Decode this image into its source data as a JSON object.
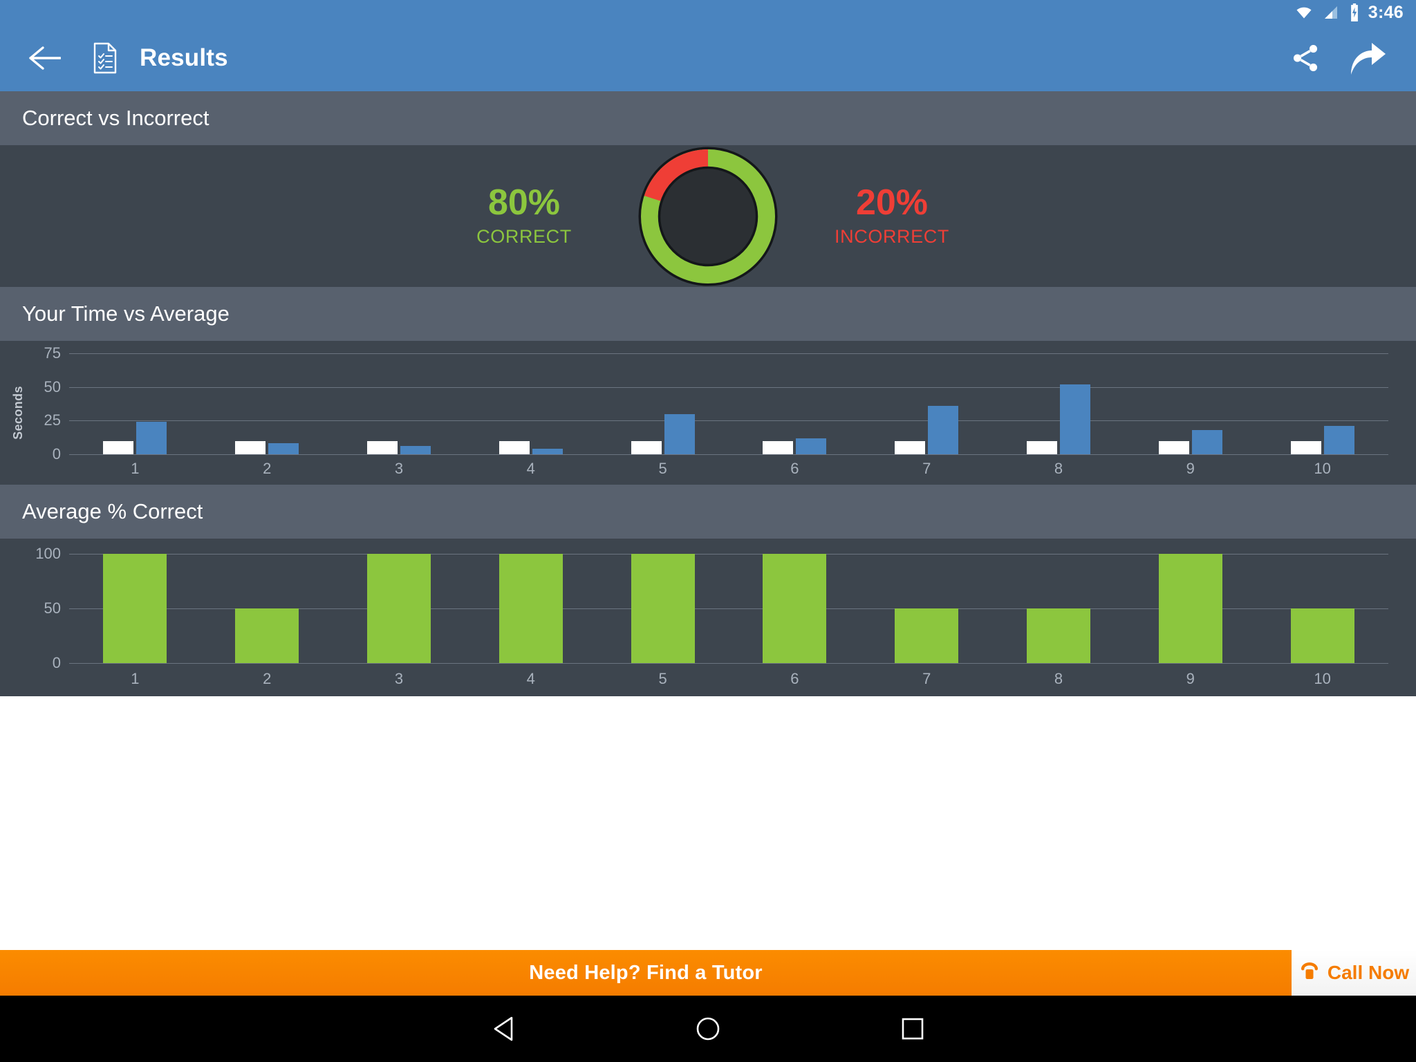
{
  "status_bar": {
    "time": "3:46",
    "icons": [
      "wifi-icon",
      "cellular-signal-icon",
      "battery-charging-icon"
    ]
  },
  "app_bar": {
    "back_label": "back-arrow",
    "doc_icon": "checklist-document-icon",
    "title": "Results",
    "actions": [
      {
        "name": "share-icon",
        "label": "Share"
      },
      {
        "name": "share-arrow-icon",
        "label": "Send"
      }
    ]
  },
  "sections": {
    "correct_vs_incorrect": {
      "header": "Correct vs Incorrect",
      "correct_value": "80%",
      "correct_label": "CORRECT",
      "incorrect_value": "20%",
      "incorrect_label": "INCORRECT"
    },
    "time_vs_average": {
      "header": "Your Time vs Average"
    },
    "average_percent_correct": {
      "header": "Average % Correct"
    }
  },
  "ad_banner": {
    "text": "Need Help? Find a Tutor",
    "call_label": "Call Now",
    "phone_icon": "telephone-icon"
  },
  "nav_bar": {
    "back": "triangle-back-icon",
    "home": "circle-home-icon",
    "recents": "square-recents-icon"
  },
  "colors": {
    "accent_blue": "#4a84bf",
    "green": "#8cc63e",
    "red": "#ef3e36",
    "orange": "#f57c00",
    "panel_bg": "#3d454e",
    "header_bg": "#58616e",
    "donut_center": "#2b2f33"
  },
  "chart_data": [
    {
      "type": "pie",
      "title": "Correct vs Incorrect",
      "labels": [
        "CORRECT",
        "INCORRECT"
      ],
      "values": [
        80,
        20
      ],
      "colors": [
        "#8cc63e",
        "#ef3e36"
      ],
      "units": "%",
      "legend": "sides"
    },
    {
      "type": "bar",
      "title": "Your Time vs Average",
      "categories": [
        "1",
        "2",
        "3",
        "4",
        "5",
        "6",
        "7",
        "8",
        "9",
        "10"
      ],
      "series": [
        {
          "name": "Average",
          "color": "#ffffff",
          "values": [
            10,
            10,
            10,
            10,
            10,
            10,
            10,
            10,
            10,
            10
          ]
        },
        {
          "name": "Your Time",
          "color": "#4a84bf",
          "values": [
            24,
            8,
            6,
            4,
            30,
            12,
            36,
            52,
            18,
            21
          ]
        }
      ],
      "xlabel": "",
      "ylabel": "Seconds",
      "yticks": [
        0,
        25,
        50,
        75
      ],
      "ylim": [
        0,
        75
      ],
      "grid": true,
      "legend_position": "none"
    },
    {
      "type": "bar",
      "title": "Average % Correct",
      "categories": [
        "1",
        "2",
        "3",
        "4",
        "5",
        "6",
        "7",
        "8",
        "9",
        "10"
      ],
      "values": [
        100,
        50,
        100,
        100,
        100,
        100,
        50,
        50,
        100,
        50
      ],
      "color": "#8cc63e",
      "xlabel": "",
      "ylabel": "",
      "yticks": [
        0,
        50,
        100
      ],
      "ylim": [
        0,
        100
      ],
      "grid": true,
      "legend_position": "none"
    }
  ]
}
